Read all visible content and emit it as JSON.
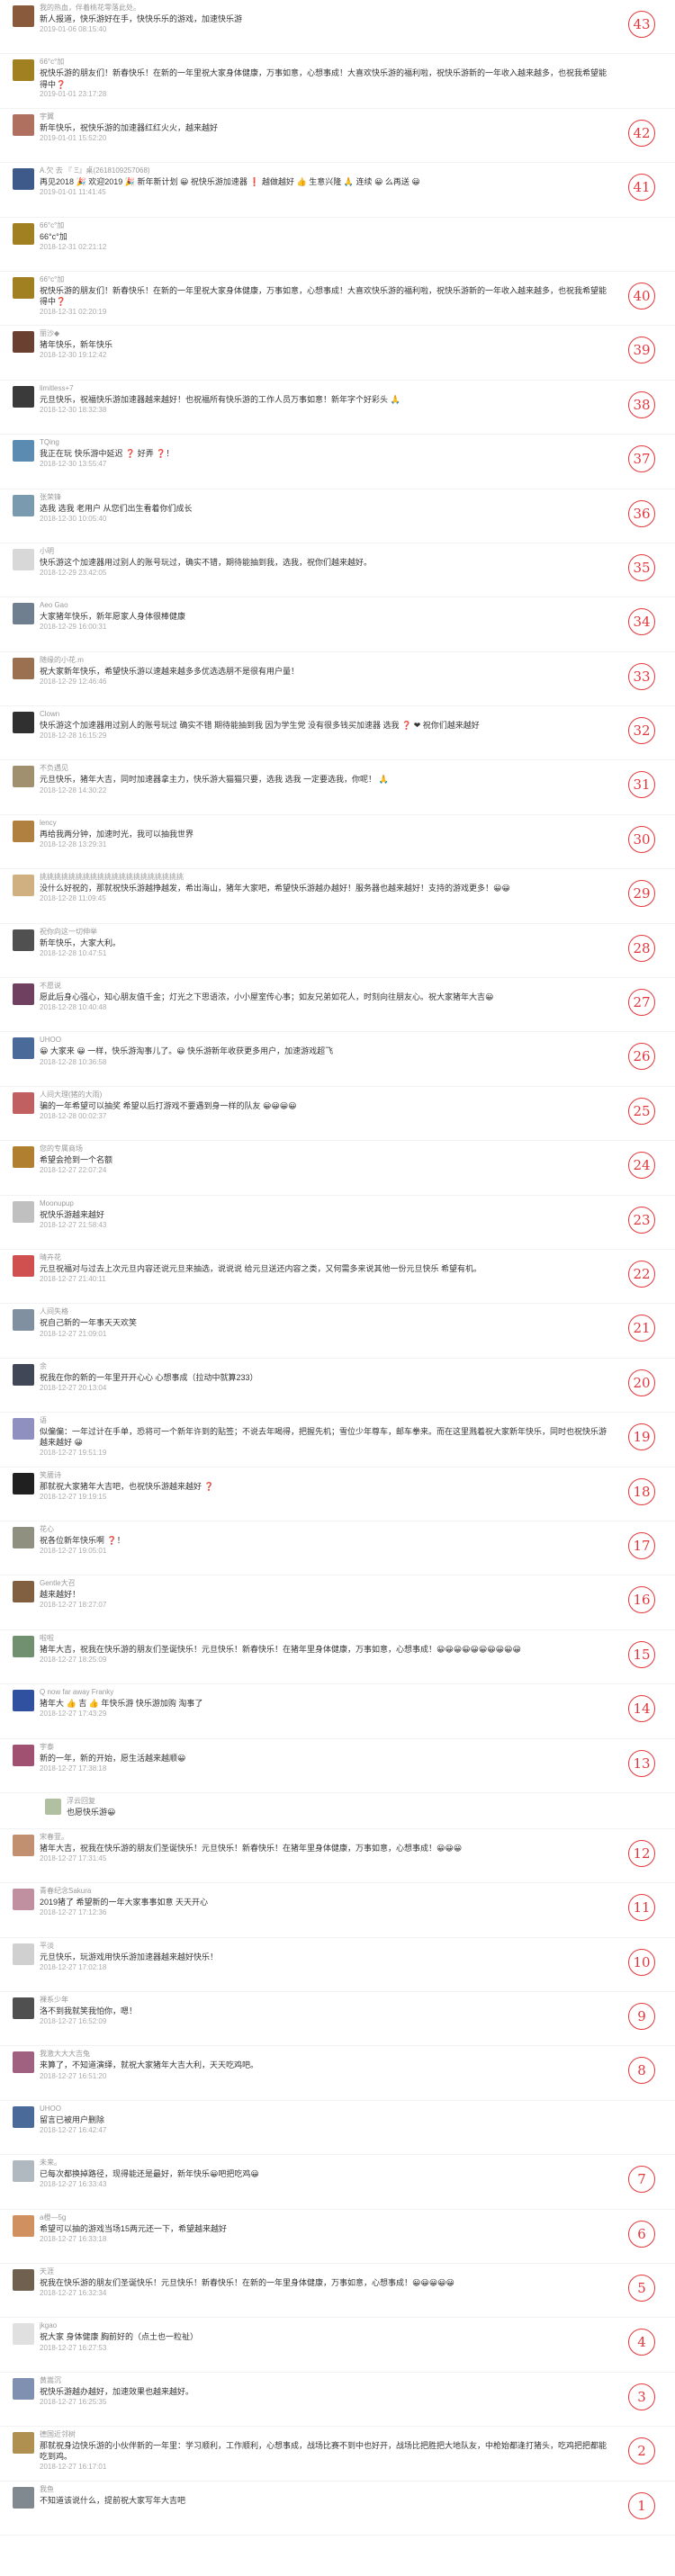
{
  "comments": [
    {
      "name": "我的热血，伴着桃花零落此处。",
      "text": "新人报道，快乐游好在手，快快乐乐的游戏，加速快乐游",
      "time": "2019-01-06 08:15:40",
      "floor": "43",
      "color": "#8a5a3c"
    },
    {
      "name": "66°c°加",
      "text": "祝快乐游的朋友们！新春快乐！在新的一年里祝大家身体健康，万事如意，心想事成！大喜欢快乐游的福利啦，祝快乐游新的一年收入越来越多，也祝我希望能得中❓",
      "time": "2019-01-01 23:17:28",
      "floor": "",
      "color": "#a08020"
    },
    {
      "name": "宇翼",
      "text": "新年快乐，祝快乐游的加速器红红火火，越来越好",
      "time": "2019-01-01 15:52:20",
      "floor": "42",
      "color": "#b07060"
    },
    {
      "name": "A.欠 去 『  Ξ』桌(2618109257068)",
      "text": "再见2018 🎉 欢迎2019 🎉 新年新计划 😀 祝快乐游加速器 ❗ 越做越好 👍 生意兴隆 🙏 连续 😀 么再送 😀",
      "time": "2019-01-01 11:41:45",
      "floor": "41",
      "color": "#3d5a8a"
    },
    {
      "name": "66°c°加",
      "text": "66°c°加",
      "time": "2018-12-31 02:21:12",
      "floor": "",
      "color": "#a08020"
    },
    {
      "name": "66°c°加",
      "text": "祝快乐游的朋友们！新春快乐！在新的一年里祝大家身体健康，万事如意，心想事成！大喜欢快乐游的福利啦，祝快乐游新的一年收入越来越多，也祝我希望能得中❓",
      "time": "2018-12-31 02:20:19",
      "floor": "40",
      "color": "#a08020"
    },
    {
      "name": "丽沙◆",
      "text": "猪年快乐，新年快乐",
      "time": "2018-12-30 19:12:42",
      "floor": "39",
      "color": "#6a4030"
    },
    {
      "name": "limitless+7",
      "text": "元旦快乐，祝福快乐游加速器越来越好！也祝福所有快乐游的工作人员万事如意！新年字个好彩头 🙏",
      "time": "2018-12-30 18:32:38",
      "floor": "38",
      "color": "#3a3a3a"
    },
    {
      "name": "TQing",
      "text": "我正在玩 快乐游中延迟 ❓ 好弄 ❓！",
      "time": "2018-12-30 13:55:47",
      "floor": "37",
      "color": "#5b8bb0"
    },
    {
      "name": "张荣锋",
      "text": "选我 选我 老用户 从您们出生看着你们成长",
      "time": "2018-12-30 10:05:40",
      "floor": "36",
      "color": "#7a9ab0"
    },
    {
      "name": "小明",
      "text": "快乐游这个加速器用过别人的账号玩过，确实不错，期待能抽到我，选我，祝你们越来越好。",
      "time": "2018-12-29 23:42:05",
      "floor": "35",
      "color": "#d8d8d8"
    },
    {
      "name": "Aeo Gao",
      "text": "大家猪年快乐，新年愿家人身体很棒健康",
      "time": "2018-12-29 16:00:31",
      "floor": "34",
      "color": "#6f7f8f"
    },
    {
      "name": "随缘的小花.m",
      "text": "祝大家新年快乐，希望快乐游以速越来越多多优选选朋不是很有用户量！",
      "time": "2018-12-29 12:46:46",
      "floor": "33",
      "color": "#9a7050"
    },
    {
      "name": "Clown",
      "text": "快乐游这个加速器用过别人的账号玩过 确实不错 期待能抽到我 因为学生党 没有很多钱买加速器 选我 ❓ ❤ 祝你们越来越好",
      "time": "2018-12-28 16:15:29",
      "floor": "32",
      "color": "#303030"
    },
    {
      "name": "不负遇见",
      "text": "元旦快乐，猪年大吉，同时加速器拿主力，快乐游大猫猫只要，选我 选我 一定要选我，你呢！ 🙏",
      "time": "2018-12-28 14:30:22",
      "floor": "31",
      "color": "#a09070"
    },
    {
      "name": "lency",
      "text": "再给我两分钟，加速时光，我可以抽我世界",
      "time": "2018-12-28 13:29:31",
      "floor": "30",
      "color": "#b08040"
    },
    {
      "name": "挑挑挑挑挑挑挑挑挑挑挑挑挑挑挑挑挑挑挑挑",
      "text": "没什么好祝的，那就祝快乐游越挣越发，希出海山，猪年大家吧，希望快乐游越办越好！服务器也越来越好！支持的游戏更多！😀😀",
      "time": "2018-12-28 11:09:45",
      "floor": "29",
      "color": "#d0b080"
    },
    {
      "name": "祝你向这一切伸举",
      "text": "新年快乐，大家大利。",
      "time": "2018-12-28 10:47:51",
      "floor": "28",
      "color": "#505050"
    },
    {
      "name": "不愿说",
      "text": "愿此后身心强心，知心朋友值千金；灯光之下思语浓，小小屋室传心事；如友兄弟如花人，时刻向往朋友心。祝大家猪年大吉😀",
      "time": "2018-12-28 10:40:48",
      "floor": "27",
      "color": "#704060"
    },
    {
      "name": "UHOO",
      "text": "😀 大家来 😀 一样，快乐游淘事儿了。😀 快乐游新年收获更多用户，加速游戏超飞",
      "time": "2018-12-28 10:36:58",
      "floor": "26",
      "color": "#4a6a9a"
    },
    {
      "name": "人间大理(猪的大雨)",
      "text": "骗的一年希望可以抽奖 希望以后打游戏不要遇到身一样的队友 😀😀😀😀",
      "time": "2018-12-28 00:02:37",
      "floor": "25",
      "color": "#c06060"
    },
    {
      "name": "您的专属商场",
      "text": "希望会抢到一个名额",
      "time": "2018-12-27 22:07:24",
      "floor": "24",
      "color": "#b08030"
    },
    {
      "name": "Moonupup",
      "text": "祝快乐游越来越好",
      "time": "2018-12-27 21:58:43",
      "floor": "23",
      "color": "#c0c0c0"
    },
    {
      "name": "晴卉花",
      "text": "元旦祝福对与过去上次元旦内容还说元旦来抽选，说说说 给元旦送还内容之类，又何需多来说其他一份元旦快乐 希望有机。",
      "time": "2018-12-27 21:40:11",
      "floor": "22",
      "color": "#d05050"
    },
    {
      "name": "人间失格",
      "text": "祝自己新的一年事天天欢笑",
      "time": "2018-12-27 21:09:01",
      "floor": "21",
      "color": "#8090a0"
    },
    {
      "name": "余",
      "text": "祝我在你的新的一年里开开心心 心想事成（拉动中就算233）",
      "time": "2018-12-27 20:13:04",
      "floor": "20",
      "color": "#404858"
    },
    {
      "name": "语",
      "text": "似偏偏：一年过计在手单，恐将可一个新年许到的贴签；不说去年喝得，把握先机；雪位少年尊车，邮车拳来。而在这里溅着祝大家新年快乐，同时也祝快乐游越来越好 😀",
      "time": "2018-12-27 19:51:19",
      "floor": "19",
      "color": "#9090c0"
    },
    {
      "name": "笑靥诗",
      "text": "那就祝大家猪年大吉吧，也祝快乐游越来越好 ❓",
      "time": "2018-12-27 19:19:15",
      "floor": "18",
      "color": "#202020"
    },
    {
      "name": "花心",
      "text": "祝各位新年快乐啊 ❓！",
      "time": "2018-12-27 19:05:01",
      "floor": "17",
      "color": "#909080"
    },
    {
      "name": "Gentle大召",
      "text": "越来越好！",
      "time": "2018-12-27 18:27:07",
      "floor": "16",
      "color": "#806040"
    },
    {
      "name": "啦啦",
      "text": "猪年大吉，祝我在快乐游的朋友们圣诞快乐！元旦快乐！新春快乐！在猪年里身体健康，万事如意，心想事成！😀😀😀😀😀😀😀😀😀😀",
      "time": "2018-12-27 18:25:09",
      "floor": "15",
      "color": "#709070"
    },
    {
      "name": "Q now far away Franky",
      "text": "猪年大 👍 吉 👍 年快乐游 快乐游加购 淘事了",
      "time": "2018-12-27 17:43:29",
      "floor": "14",
      "color": "#3050a0"
    },
    {
      "name": "宇泰",
      "text": "新的一年，新的开始，愿生活越来越顺😀",
      "time": "2018-12-27 17:38:18",
      "floor": "13",
      "color": "#a05070"
    },
    {
      "name": "浮云回复",
      "text": "也愿快乐游😀",
      "time": "",
      "floor": "",
      "color": "#b0c0a0",
      "sub": true
    },
    {
      "name": "宋春萱。",
      "text": "猪年大吉，祝我在快乐游的朋友们圣诞快乐！元旦快乐！新春快乐！在猪年里身体健康，万事如意，心想事成！😀😀😀",
      "time": "2018-12-27 17:31:45",
      "floor": "12",
      "color": "#c09070"
    },
    {
      "name": "青春纪念Sakura",
      "text": "2019猪了 希望新的一年大家事事如意 天天开心",
      "time": "2018-12-27 17:12:36",
      "floor": "11",
      "color": "#c090a0"
    },
    {
      "name": "平淡",
      "text": "元旦快乐，玩游戏用快乐游加速器越来越好快乐！",
      "time": "2018-12-27 17:02:18",
      "floor": "10",
      "color": "#d0d0d0"
    },
    {
      "name": "裸系少年",
      "text": "洛不到我就笑我怕你，嗯！",
      "time": "2018-12-27 16:52:09",
      "floor": "9",
      "color": "#505050"
    },
    {
      "name": "我激大大大吉兔",
      "text": "来算了，不知道演绎，就祝大家猪年大吉大利，天天吃鸡吧。",
      "time": "2018-12-27 16:51:20",
      "floor": "8",
      "color": "#a06080"
    },
    {
      "name": "UHOO",
      "text": "留言已被用户删除",
      "time": "2018-12-27 16:42:47",
      "floor": "",
      "color": "#4a6a9a"
    },
    {
      "name": "未来。",
      "text": "已每次都换掉路径，现得能还是最好，新年快乐😀吧把吃鸡😀",
      "time": "2018-12-27 16:33:43",
      "floor": "7",
      "color": "#b0b8c0"
    },
    {
      "name": "a橙—5g",
      "text": "希望可以抽的游戏当场15两元还一下，希望越来越好",
      "time": "2018-12-27 16:33:18",
      "floor": "6",
      "color": "#d09060"
    },
    {
      "name": "天涯",
      "text": "祝我在快乐游的朋友们圣诞快乐！元旦快乐！新春快乐！在新的一年里身体健康，万事如意，心想事成！😀😀😀😀😀",
      "time": "2018-12-27 16:32:34",
      "floor": "5",
      "color": "#706050"
    },
    {
      "name": "jkgao",
      "text": "祝大家 身体健康 胸前好的（点土也一粒祉）",
      "time": "2018-12-27 16:27:53",
      "floor": "4",
      "color": "#e0e0e0"
    },
    {
      "name": "黄嵩沉",
      "text": "祝快乐游越办越好，加速效果也越来越好。",
      "time": "2018-12-27 16:25:35",
      "floor": "3",
      "color": "#8090b0"
    },
    {
      "name": "德国近邻树",
      "text": "那就祝身边快乐游的小伙伴新的一年里：学习顺利，工作顺利，心想事成，战场比赛不到中也好开，战场比把胜把大地队友，中枪始都逢打猪头，吃鸡把把都能吃到鸡。",
      "time": "2018-12-27 16:17:01",
      "floor": "2",
      "color": "#b09050"
    },
    {
      "name": "我鱼",
      "text": "不知道该说什么，提前祝大家写年大吉吧",
      "time": "",
      "floor": "1",
      "color": "#808890"
    }
  ]
}
